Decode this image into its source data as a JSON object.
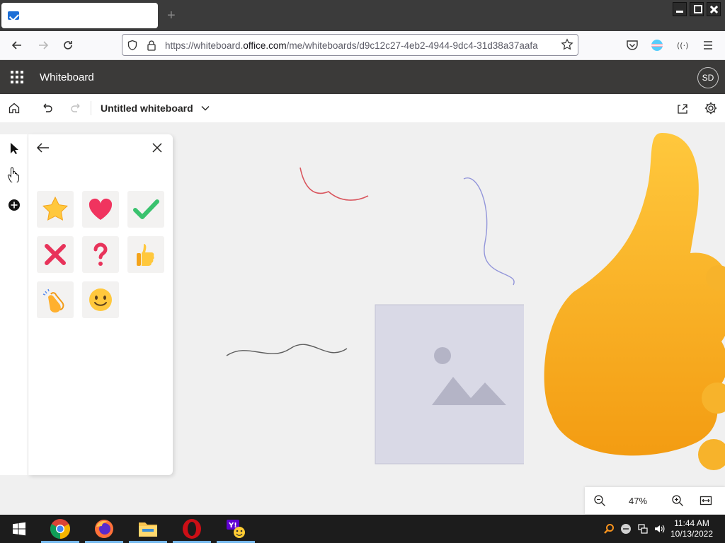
{
  "browser": {
    "tab_title": "",
    "new_tab": "+",
    "url_host_prefix": "https://whiteboard.",
    "url_host": "office.com",
    "url_path": "/me/whiteboards/d9c12c27-4eb2-4944-9dc4-31d38a37aafa"
  },
  "app": {
    "name": "Whiteboard",
    "avatar_initials": "SD"
  },
  "toolbar": {
    "board_title": "Untitled whiteboard"
  },
  "canvas": {
    "content_note": "Canvas contains user-drawn ink scribbles and inserted images."
  },
  "reactions_panel": {
    "items": [
      {
        "name": "star",
        "icon": "star-icon"
      },
      {
        "name": "heart",
        "icon": "heart-icon"
      },
      {
        "name": "check",
        "icon": "checkmark-icon"
      },
      {
        "name": "cross",
        "icon": "cross-icon"
      },
      {
        "name": "question",
        "icon": "question-icon"
      },
      {
        "name": "thumbs-up",
        "icon": "thumbs-up-icon"
      },
      {
        "name": "clap",
        "icon": "clapping-hands-icon"
      },
      {
        "name": "smile",
        "icon": "smiley-icon"
      }
    ]
  },
  "zoom": {
    "level": "47%"
  },
  "taskbar": {
    "apps": [
      "Windows start",
      "Google Chrome",
      "Firefox",
      "File Explorer",
      "Opera",
      "Yahoo"
    ],
    "time": "11:44 AM",
    "date": "10/13/2022"
  },
  "colors": {
    "app_header": "#3b3a39",
    "canvas": "#f0f0f0",
    "taskbar": "#1c1c1c",
    "taskbar_running_indicator": "#76b9ed"
  }
}
